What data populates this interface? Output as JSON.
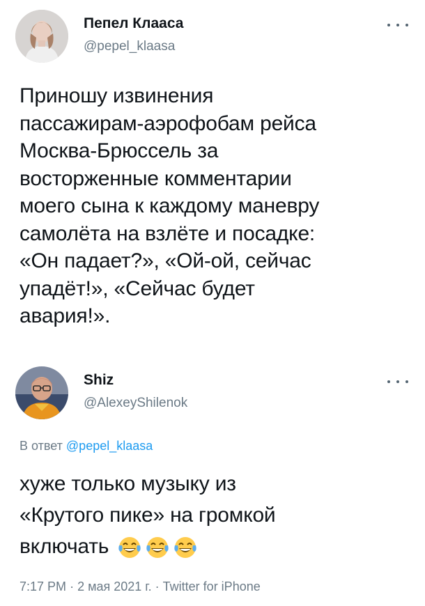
{
  "tweet1": {
    "avatar_icon": "user-avatar-woman",
    "name": "Пепел Клааса",
    "handle": "@pepel_klaasa",
    "more_icon": "more-horizontal-icon",
    "text_lines": [
      "Приношу извинения",
      "пассажирам-аэрофобам рейса",
      "Москва-Брюссель за",
      "восторженные комментарии",
      "моего сына к каждому маневру",
      "самолёта на взлёте и посадке:",
      "«Он падает?», «Ой-ой, сейчас",
      "упадёт!», «Сейчас будет",
      "авария!»."
    ]
  },
  "tweet2": {
    "avatar_icon": "user-avatar-man",
    "name": "Shiz",
    "handle": "@AlexeyShilenok",
    "more_icon": "more-horizontal-icon",
    "reply_prefix": "В ответ",
    "reply_mention": "@pepel_klaasa",
    "text_lines": [
      "хуже только музыку из",
      "«Крутого пике» на громкой",
      "включать"
    ],
    "emojis": [
      "face-with-tears-of-joy-emoji",
      "face-with-tears-of-joy-emoji",
      "face-with-tears-of-joy-emoji"
    ],
    "time": "7:17 PM",
    "date": "2 мая 2021 г.",
    "separator": "·",
    "source": "Twitter for iPhone"
  },
  "colors": {
    "text": "#0f1419",
    "secondary": "#6b7a86",
    "link": "#1d9bf0"
  }
}
